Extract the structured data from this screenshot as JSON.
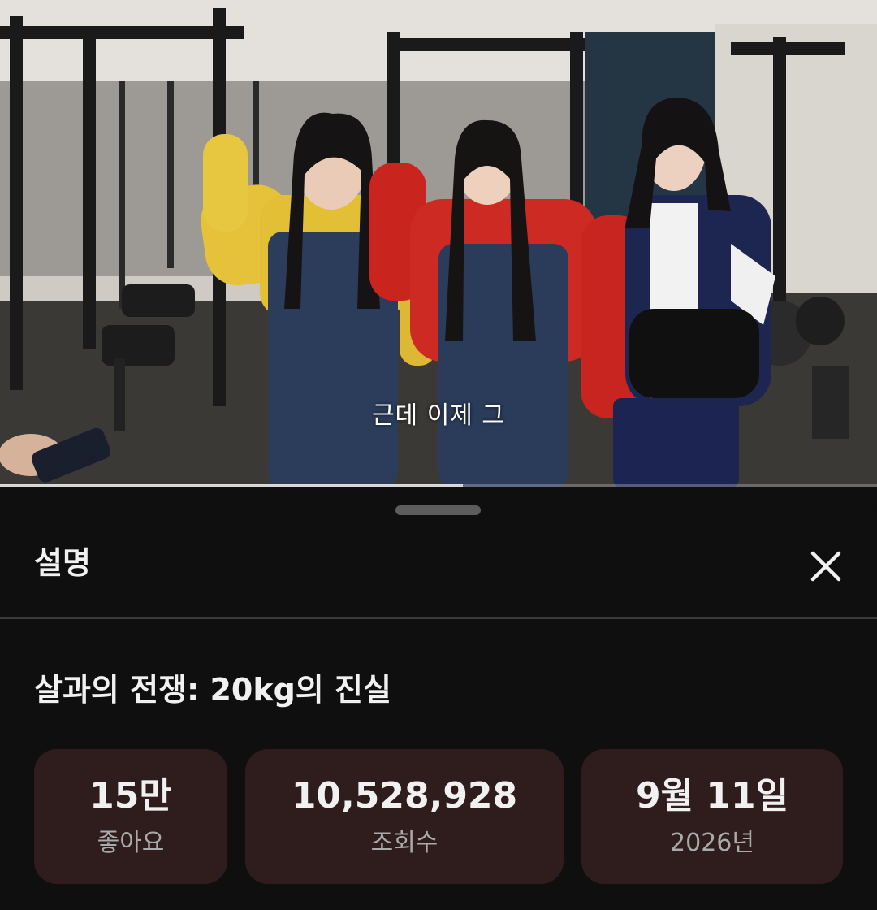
{
  "video": {
    "caption": "근데 이제 그",
    "progress": 0.528
  },
  "description_sheet": {
    "title": "설명",
    "close_icon": "close-icon",
    "video_title": "살과의 전쟁: 20kg의 진실",
    "stats": {
      "likes": {
        "value": "15만",
        "label": "좋아요"
      },
      "views": {
        "value": "10,528,928",
        "label": "조회수"
      },
      "date": {
        "value": "9월 11일",
        "label": "2026년"
      }
    },
    "colors": {
      "background": "#0f0f0f",
      "stat_card": "#2f1d1d",
      "text_primary": "#f1f1f1",
      "text_secondary": "#aaaaaa"
    }
  }
}
